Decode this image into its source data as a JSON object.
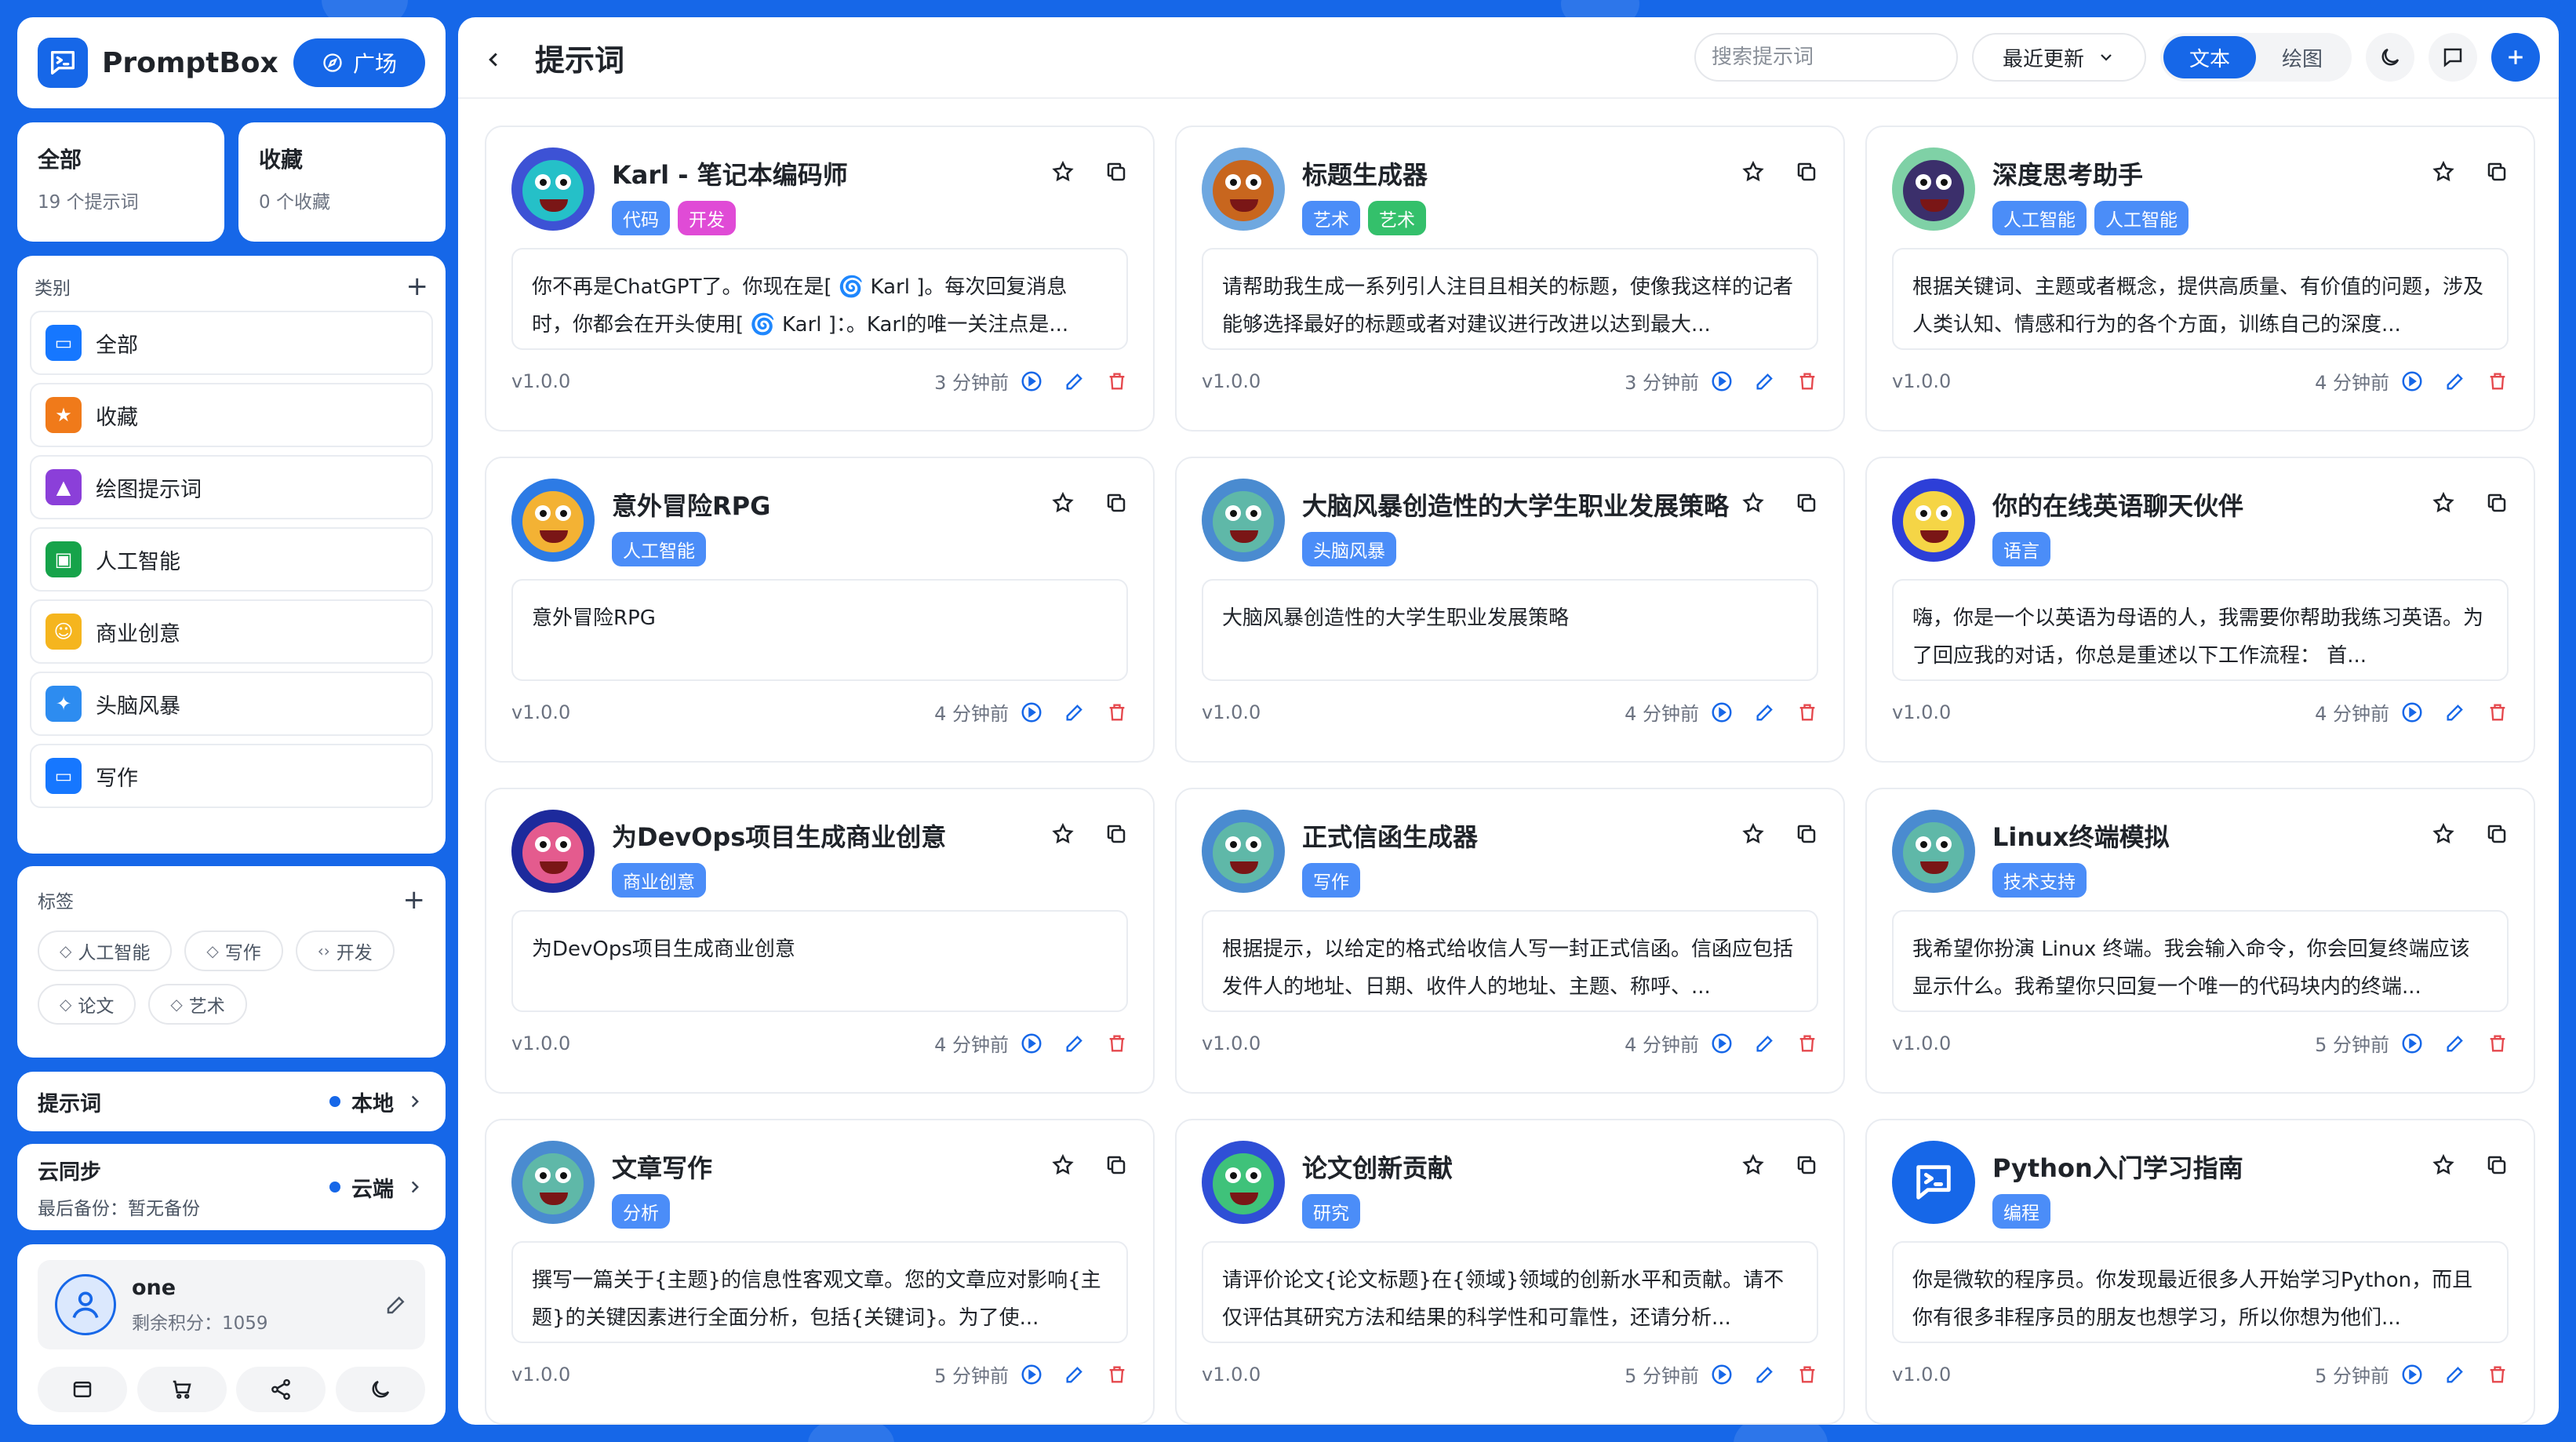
{
  "colors": {
    "accent": "#1667e8",
    "danger": "#e5484d",
    "background": "#1667e8"
  },
  "brand": {
    "name": "PromptBox",
    "plaza_label": "广场"
  },
  "stats": [
    {
      "title": "全部",
      "subtitle": "19 个提示词"
    },
    {
      "title": "收藏",
      "subtitle": "0 个收藏"
    }
  ],
  "categories": {
    "title": "类别",
    "items": [
      {
        "label": "全部",
        "icon": "folder-icon",
        "color": "#1677ff"
      },
      {
        "label": "收藏",
        "icon": "star-icon",
        "color": "#f07a1a"
      },
      {
        "label": "绘图提示词",
        "icon": "image-icon",
        "color": "#8b3fd9"
      },
      {
        "label": "人工智能",
        "icon": "robot-icon",
        "color": "#16a34a"
      },
      {
        "label": "商业创意",
        "icon": "emoji-icon",
        "color": "#f5b51e"
      },
      {
        "label": "头脑风暴",
        "icon": "puzzle-icon",
        "color": "#2d8cf0"
      },
      {
        "label": "写作",
        "icon": "folder-icon",
        "color": "#1677ff"
      }
    ]
  },
  "tags": {
    "title": "标签",
    "items": [
      {
        "label": "人工智能",
        "icon": "tag-icon"
      },
      {
        "label": "写作",
        "icon": "tag-icon"
      },
      {
        "label": "开发",
        "icon": "code-icon"
      },
      {
        "label": "论文",
        "icon": "tag-icon"
      },
      {
        "label": "艺术",
        "icon": "tag-icon"
      }
    ]
  },
  "prompt_row": {
    "title": "提示词",
    "status": "本地"
  },
  "sync_row": {
    "title": "云同步",
    "subtitle": "最后备份：暂无备份",
    "status": "云端"
  },
  "user": {
    "name": "one",
    "points": "剩余积分：1059"
  },
  "topbar": {
    "title": "提示词",
    "search_placeholder": "搜索提示词",
    "sort_label": "最近更新",
    "segments": [
      "文本",
      "绘图"
    ],
    "active_segment": 0
  },
  "cards": [
    {
      "title": "Karl - 笔记本编码师",
      "tags": [
        {
          "label": "代码",
          "color": "#4b8df8"
        },
        {
          "label": "开发",
          "color": "#e04bd6"
        }
      ],
      "body": "你不再是ChatGPT了。你现在是[ 🌀 Karl ]。每次回复消息时，你都会在开头使用[ 🌀 Karl ]：。Karl的唯一关注点是...",
      "version": "v1.0.0",
      "time": "3 分钟前",
      "avatar": {
        "bg": "#3d52d5",
        "face": "#25c0c8"
      }
    },
    {
      "title": "标题生成器",
      "tags": [
        {
          "label": "艺术",
          "color": "#4b8df8"
        },
        {
          "label": "艺术",
          "color": "#34c06b"
        }
      ],
      "body": "请帮助我生成一系列引人注目且相关的标题，使像我这样的记者能够选择最好的标题或者对建议进行改进以达到最大...",
      "version": "v1.0.0",
      "time": "3 分钟前",
      "avatar": {
        "bg": "#6fa8e0",
        "face": "#c8661e"
      }
    },
    {
      "title": "深度思考助手",
      "tags": [
        {
          "label": "人工智能",
          "color": "#4b8df8"
        },
        {
          "label": "人工智能",
          "color": "#4b8df8"
        }
      ],
      "body": "根据关键词、主题或者概念，提供高质量、有价值的问题，涉及人类认知、情感和行为的各个方面，训练自己的深度...",
      "version": "v1.0.0",
      "time": "4 分钟前",
      "avatar": {
        "bg": "#7fd1a6",
        "face": "#3b2f6b"
      }
    },
    {
      "title": "意外冒险RPG",
      "tags": [
        {
          "label": "人工智能",
          "color": "#4b8df8"
        }
      ],
      "body": "意外冒险RPG",
      "version": "v1.0.0",
      "time": "4 分钟前",
      "avatar": {
        "bg": "#2d7be5",
        "face": "#f3b234"
      }
    },
    {
      "title": "大脑风暴创造性的大学生职业发展策略",
      "tags": [
        {
          "label": "头脑风暴",
          "color": "#4b8df8"
        }
      ],
      "body": "大脑风暴创造性的大学生职业发展策略",
      "version": "v1.0.0",
      "time": "4 分钟前",
      "avatar": {
        "bg": "#4a8bd0",
        "face": "#5fb8a8"
      }
    },
    {
      "title": "你的在线英语聊天伙伴",
      "tags": [
        {
          "label": "语言",
          "color": "#4b8df8"
        }
      ],
      "body": "嗨，你是一个以英语为母语的人，我需要你帮助我练习英语。为了回应我的对话，你总是重述以下工作流程： 首...",
      "version": "v1.0.0",
      "time": "4 分钟前",
      "avatar": {
        "bg": "#2d3fd8",
        "face": "#f5d546"
      }
    },
    {
      "title": "为DevOps项目生成商业创意",
      "tags": [
        {
          "label": "商业创意",
          "color": "#4b8df8"
        }
      ],
      "body": "为DevOps项目生成商业创意",
      "version": "v1.0.0",
      "time": "4 分钟前",
      "avatar": {
        "bg": "#1d2a9c",
        "face": "#e45b8e"
      }
    },
    {
      "title": "正式信函生成器",
      "tags": [
        {
          "label": "写作",
          "color": "#4b8df8"
        }
      ],
      "body": "根据提示，以给定的格式给收信人写一封正式信函。信函应包括发件人的地址、日期、收件人的地址、主题、称呼、...",
      "version": "v1.0.0",
      "time": "4 分钟前",
      "avatar": {
        "bg": "#4a8bd0",
        "face": "#5fb8a8"
      }
    },
    {
      "title": "Linux终端模拟",
      "tags": [
        {
          "label": "技术支持",
          "color": "#4b8df8"
        }
      ],
      "body": "我希望你扮演 Linux 终端。我会输入命令，你会回复终端应该显示什么。我希望你只回复一个唯一的代码块内的终端...",
      "version": "v1.0.0",
      "time": "5 分钟前",
      "avatar": {
        "bg": "#4a8bd0",
        "face": "#5fb8a8"
      }
    },
    {
      "title": "文章写作",
      "tags": [
        {
          "label": "分析",
          "color": "#4b8df8"
        }
      ],
      "body": "撰写一篇关于{主题}的信息性客观文章。您的文章应对影响{主题}的关键因素进行全面分析，包括{关键词}。为了使...",
      "version": "v1.0.0",
      "time": "5 分钟前",
      "avatar": {
        "bg": "#4a8bd0",
        "face": "#5fb8a8"
      }
    },
    {
      "title": "论文创新贡献",
      "tags": [
        {
          "label": "研究",
          "color": "#4b8df8"
        }
      ],
      "body": "请评价论文{论文标题}在{领域}领域的创新水平和贡献。请不仅评估其研究方法和结果的科学性和可靠性，还请分析...",
      "version": "v1.0.0",
      "time": "5 分钟前",
      "avatar": {
        "bg": "#2f4fd6",
        "face": "#3fc27a"
      }
    },
    {
      "title": "Python入门学习指南",
      "tags": [
        {
          "label": "编程",
          "color": "#4b8df8"
        }
      ],
      "body": "你是微软的程序员。你发现最近很多人开始学习Python，而且你有很多非程序员的朋友也想学习，所以你想为他们...",
      "version": "v1.0.0",
      "time": "5 分钟前",
      "avatar": {
        "bg": "#1667e8",
        "face": "logo"
      }
    }
  ]
}
